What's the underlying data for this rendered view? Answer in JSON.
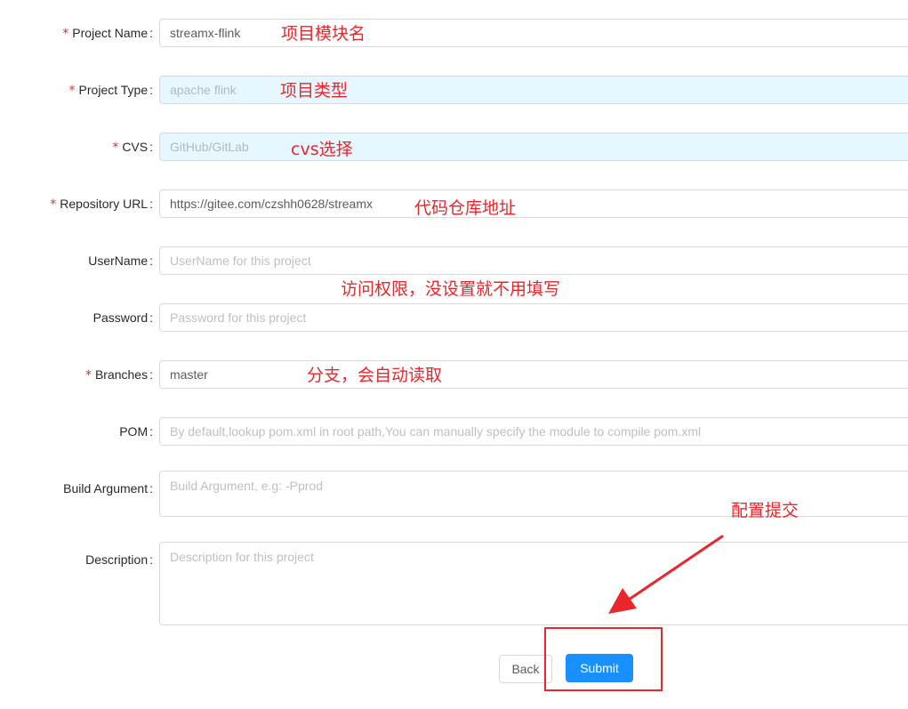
{
  "form": {
    "fields": [
      {
        "label": "Project Name",
        "required": true,
        "value": "streamx-flink",
        "placeholder": "",
        "disabled": false
      },
      {
        "label": "Project Type",
        "required": true,
        "value": "",
        "placeholder": "apache flink",
        "disabled": true
      },
      {
        "label": "CVS",
        "required": true,
        "value": "",
        "placeholder": "GitHub/GitLab",
        "disabled": true
      },
      {
        "label": "Repository URL",
        "required": true,
        "value": "https://gitee.com/czshh0628/streamx",
        "placeholder": "",
        "disabled": false
      },
      {
        "label": "UserName",
        "required": false,
        "value": "",
        "placeholder": "UserName for this project",
        "disabled": false
      },
      {
        "label": "Password",
        "required": false,
        "value": "",
        "placeholder": "Password for this project",
        "disabled": false
      },
      {
        "label": "Branches",
        "required": true,
        "value": "master",
        "placeholder": "",
        "disabled": false
      },
      {
        "label": "POM",
        "required": false,
        "value": "",
        "placeholder": "By default,lookup pom.xml in root path,You can manually specify the module to compile pom.xml",
        "disabled": false
      },
      {
        "label": "Build Argument",
        "required": false,
        "value": "",
        "placeholder": "Build Argument, e.g: -Pprod",
        "disabled": false
      },
      {
        "label": "Description",
        "required": false,
        "value": "",
        "placeholder": "Description for this project",
        "disabled": false
      }
    ],
    "required_mark": "*",
    "colon": ":"
  },
  "buttons": {
    "back": "Back",
    "submit": "Submit"
  },
  "annotations": {
    "project_name": "项目模块名",
    "project_type": "项目类型",
    "cvs": "cvs选择",
    "repository_url": "代码仓库地址",
    "credentials": "访问权限，没设置就不用填写",
    "branches": "分支，会自动读取",
    "submit": "配置提交"
  },
  "colors": {
    "primary": "#1890ff",
    "required": "#f5222d",
    "annotation": "#e8262b",
    "disabled_bg": "#e6f7ff"
  }
}
